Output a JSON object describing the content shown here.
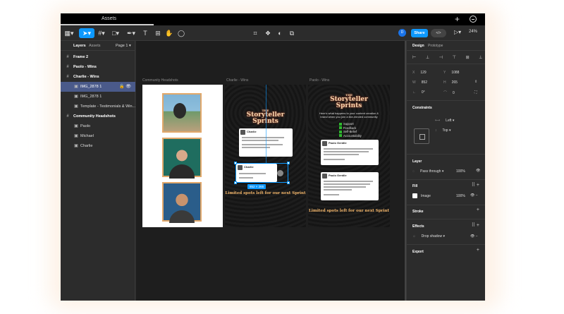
{
  "window": {
    "tab_title": "Assets",
    "plus_icon": "plus-icon",
    "menu_icon": "circle-menu-icon"
  },
  "toolbar": {
    "share_label": "Share",
    "zoom_label": "24%",
    "dev_label": "</>",
    "avatar_initial": "D"
  },
  "layers_panel": {
    "tab_layers": "Layers",
    "tab_assets": "Assets",
    "page_label": "Page 1",
    "items": [
      {
        "label": "Frame 2",
        "type": "frame"
      },
      {
        "label": "Paolo - Wins",
        "type": "frame"
      },
      {
        "label": "Charlie - Wins",
        "type": "frame"
      },
      {
        "label": "IMG_2878 1",
        "type": "image",
        "selected": true
      },
      {
        "label": "IMG_2878 1",
        "type": "image"
      },
      {
        "label": "Template - Testimonials & Win...",
        "type": "image"
      },
      {
        "label": "Community Headshots",
        "type": "frame"
      },
      {
        "label": "Paolo",
        "type": "image"
      },
      {
        "label": "Michael",
        "type": "image"
      },
      {
        "label": "Charlie",
        "type": "image"
      }
    ]
  },
  "canvas": {
    "frame_labels": [
      "Community Headshots",
      "Charlie - Wins",
      "Paolo - Wins"
    ],
    "logo_the": "THE",
    "logo_line1": "Storyteller",
    "logo_line2": "Sprints",
    "intro_text": "Here's what happens to your content creation & brand when you join a like-minded community",
    "checklist": [
      "Support",
      "Feedback",
      "Self-Belief",
      "Accountability"
    ],
    "card_names": [
      "Charlie",
      "Charlie",
      "Paolo Gentile",
      "Paolo Gentile"
    ],
    "cta_text": "Limited spots left for our next Sprint",
    "size_tag": "852 × 265"
  },
  "design_panel": {
    "tab_design": "Design",
    "tab_prototype": "Prototype",
    "x_label": "X",
    "x_value": "129",
    "y_label": "Y",
    "y_value": "1088",
    "w_label": "W",
    "w_value": "852",
    "h_label": "H",
    "h_value": "265",
    "rotation_value": "0°",
    "radius_value": "0",
    "constraints_title": "Constraints",
    "constraint_h": "Left",
    "constraint_v": "Top",
    "layer_title": "Layer",
    "blend_mode": "Pass through",
    "layer_opacity": "100%",
    "fill_title": "Fill",
    "fill_type": "Image",
    "fill_opacity": "100%",
    "stroke_title": "Stroke",
    "effects_title": "Effects",
    "effect_name": "Drop shadow",
    "export_title": "Export"
  }
}
